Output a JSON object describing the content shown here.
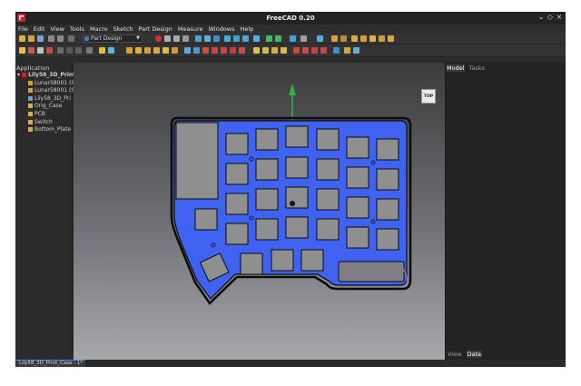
{
  "window": {
    "title": "FreeCAD 0.20"
  },
  "menu": [
    "File",
    "Edit",
    "View",
    "Tools",
    "Macro",
    "Sketch",
    "Part Design",
    "Measure",
    "Windows",
    "Help"
  ],
  "toolbar": {
    "workbench": "Part Design"
  },
  "combo_view": {
    "header": "Application",
    "tree": [
      {
        "label": "Lily58_3D_Print_",
        "level": 0,
        "bold": true
      },
      {
        "label": "Lunar58001 (Se",
        "level": 1
      },
      {
        "label": "Lunar58001 (Se",
        "level": 1
      },
      {
        "label": "Lily58_3D_Pri",
        "level": 1
      },
      {
        "label": "Orig_Case",
        "level": 1
      },
      {
        "label": "PCB",
        "level": 1
      },
      {
        "label": "Switch",
        "level": 1
      },
      {
        "label": "Bottom_Plate",
        "level": 1
      }
    ]
  },
  "navcube": {
    "face": "TOP"
  },
  "right_panel": {
    "tabs": [
      "Model",
      "Tasks"
    ],
    "bottom_tabs": [
      "View",
      "Data"
    ]
  },
  "status": {
    "document_tab": "Lily58_3D_Print_Case : 1*"
  },
  "colors": {
    "case_fill": "#3f63f0",
    "model_outline": "#0b0b0b",
    "switch_gray": "#8f8f8f",
    "axis_green": "#2db34a",
    "axis_red": "#e02020"
  }
}
